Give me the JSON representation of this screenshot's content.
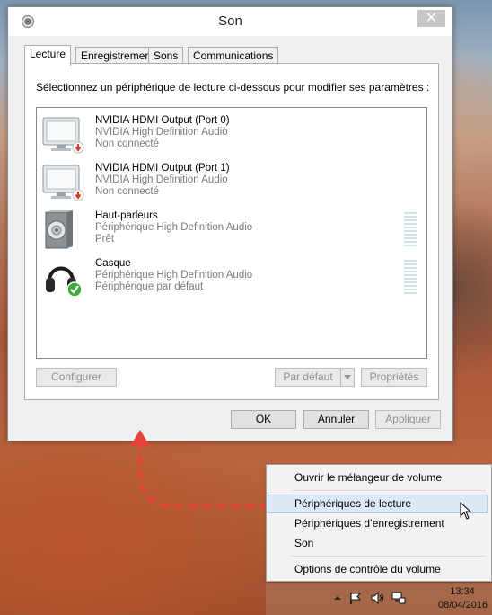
{
  "window": {
    "title": "Son",
    "close_glyph": "✕"
  },
  "tabs": [
    {
      "label": "Lecture",
      "active": true
    },
    {
      "label": "Enregistrement",
      "active": false
    },
    {
      "label": "Sons",
      "active": false
    },
    {
      "label": "Communications",
      "active": false
    }
  ],
  "instruction": "Sélectionnez un périphérique de lecture ci-dessous pour modifier ses paramètres :",
  "devices": [
    {
      "name": "NVIDIA HDMI Output (Port 0)",
      "driver": "NVIDIA High Definition Audio",
      "status": "Non connecté",
      "icon": "monitor-disconnected-icon"
    },
    {
      "name": "NVIDIA HDMI Output (Port 1)",
      "driver": "NVIDIA High Definition Audio",
      "status": "Non connecté",
      "icon": "monitor-disconnected-icon"
    },
    {
      "name": "Haut-parleurs",
      "driver": "Périphérique High Definition Audio",
      "status": "Prêt",
      "icon": "speaker-icon"
    },
    {
      "name": "Casque",
      "driver": "Périphérique High Definition Audio",
      "status": "Périphérique par défaut",
      "icon": "headphones-default-icon"
    }
  ],
  "panel_buttons": {
    "configure": "Configurer",
    "default": "Par défaut",
    "properties": "Propriétés"
  },
  "dialog_buttons": {
    "ok": "OK",
    "cancel": "Annuler",
    "apply": "Appliquer"
  },
  "context_menu": {
    "items": [
      "Ouvrir le mélangeur de volume",
      "Périphériques de lecture",
      "Périphériques d’enregistrement",
      "Son",
      "Options de contrôle du volume"
    ],
    "highlighted_index": 1
  },
  "taskbar": {
    "time": "13:34",
    "date": "08/04/2016",
    "tray_icons": [
      "chevron-up-icon",
      "flag-icon",
      "volume-icon",
      "network-icon"
    ]
  },
  "colors": {
    "accent_arrow": "#e8433a",
    "default_check": "#3caa3c",
    "disconnected_badge": "#d83a2c"
  }
}
